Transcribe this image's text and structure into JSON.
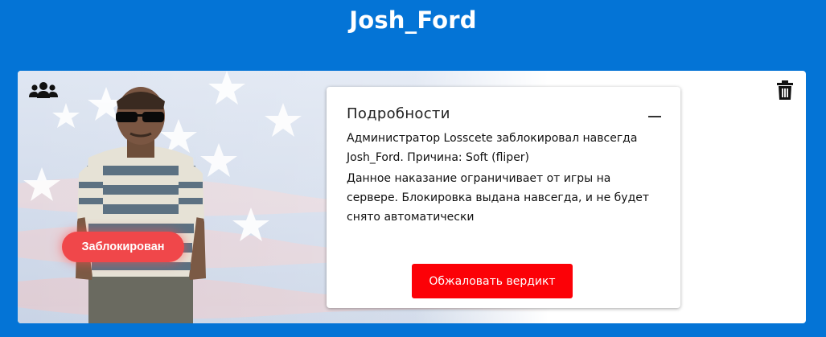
{
  "header": {
    "title": "Josh_Ford"
  },
  "card": {
    "status_badge": "Заблокирован",
    "group_icon": "users-group-icon",
    "delete_icon": "trash-icon",
    "colors": {
      "badge": "#f0474a",
      "appeal_button": "#fc0107",
      "page_bg": "#0474d6"
    }
  },
  "details": {
    "title": "Подробности",
    "collapse_icon": "minus-icon",
    "text_1": "Администратор Losscete заблокировал навсегда Josh_Ford. Причина: Soft (fliper)",
    "text_2": "Данное наказание ограничивает от игры на сервере. Блокировка выдана навсегда, и не будет снято автоматически",
    "appeal_label": "Обжаловать вердикт"
  }
}
